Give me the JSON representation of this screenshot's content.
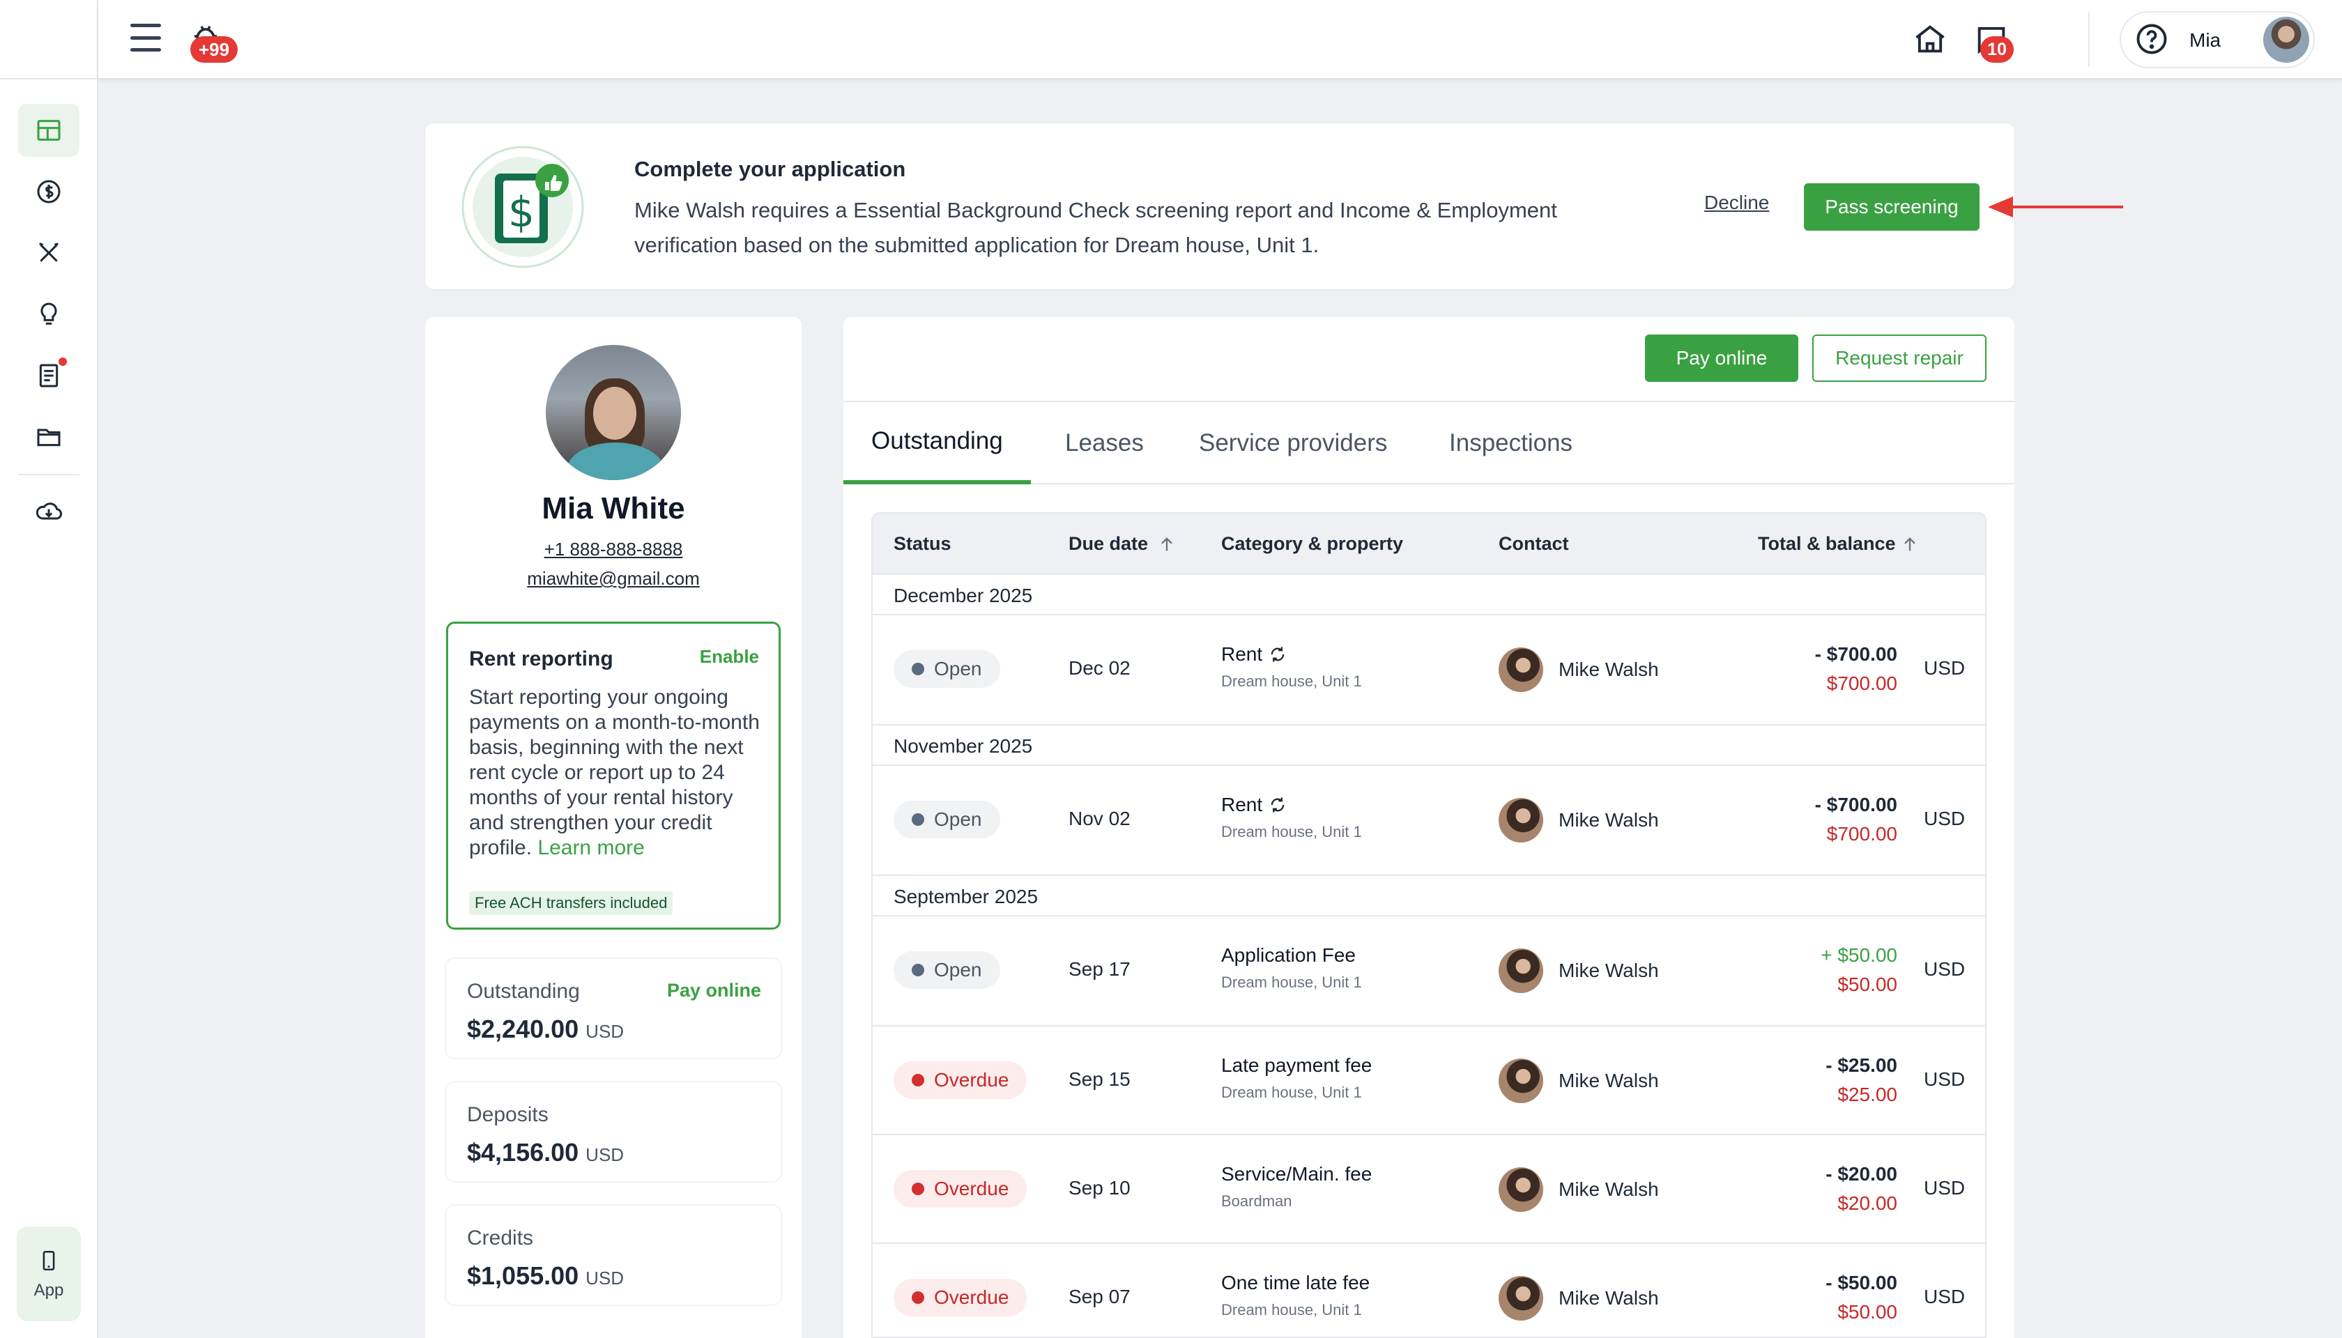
{
  "topbar": {
    "notif_count": "+99",
    "chat_count": "10",
    "user_name": "Mia"
  },
  "rail": {
    "app_label": "App"
  },
  "banner": {
    "title": "Complete your application",
    "text": "Mike Walsh requires a Essential Background Check screening report and Income & Employment verification based on the submitted application for Dream house, Unit 1.",
    "decline": "Decline",
    "pass": "Pass screening"
  },
  "profile": {
    "name": "Mia White",
    "phone": "+1 888-888-8888",
    "email": "miawhite@gmail.com",
    "rent_reporting": {
      "title": "Rent reporting",
      "enable": "Enable",
      "text": "Start reporting your ongoing payments on a month-to-month basis, beginning with the next rent cycle or report up to 24 months of your rental history and strengthen your credit profile.",
      "learn_more": "Learn more",
      "tag": "Free ACH transfers included"
    },
    "outstanding": {
      "label": "Outstanding",
      "link": "Pay online",
      "value": "$2,240.00",
      "currency": "USD"
    },
    "deposits": {
      "label": "Deposits",
      "value": "$4,156.00",
      "currency": "USD"
    },
    "credits": {
      "label": "Credits",
      "value": "$1,055.00",
      "currency": "USD"
    }
  },
  "main": {
    "pay_online": "Pay online",
    "request_repair": "Request repair",
    "tabs": [
      "Outstanding",
      "Leases",
      "Service providers",
      "Inspections"
    ],
    "columns": {
      "status": "Status",
      "due": "Due date",
      "category": "Category & property",
      "contact": "Contact",
      "total": "Total & balance"
    },
    "groups": [
      "December 2025",
      "November 2025",
      "September 2025"
    ],
    "rows": [
      {
        "status": "Open",
        "due": "Dec 02",
        "category": "Rent",
        "property": "Dream house, Unit 1",
        "contact": "Mike Walsh",
        "total": "- $700.00",
        "balance": "$700.00",
        "currency": "USD"
      },
      {
        "status": "Open",
        "due": "Nov 02",
        "category": "Rent",
        "property": "Dream house, Unit 1",
        "contact": "Mike Walsh",
        "total": "- $700.00",
        "balance": "$700.00",
        "currency": "USD"
      },
      {
        "status": "Open",
        "due": "Sep 17",
        "category": "Application Fee",
        "property": "Dream house, Unit 1",
        "contact": "Mike Walsh",
        "total": "+ $50.00",
        "balance": "$50.00",
        "currency": "USD"
      },
      {
        "status": "Overdue",
        "due": "Sep 15",
        "category": "Late payment fee",
        "property": "Dream house, Unit 1",
        "contact": "Mike Walsh",
        "total": "- $25.00",
        "balance": "$25.00",
        "currency": "USD"
      },
      {
        "status": "Overdue",
        "due": "Sep 10",
        "category": "Service/Main. fee",
        "property": "Boardman",
        "contact": "Mike Walsh",
        "total": "- $20.00",
        "balance": "$20.00",
        "currency": "USD"
      },
      {
        "status": "Overdue",
        "due": "Sep 07",
        "category": "One time late fee",
        "property": "Dream house, Unit 1",
        "contact": "Mike Walsh",
        "total": "- $50.00",
        "balance": "$50.00",
        "currency": "USD"
      }
    ]
  },
  "colors": {
    "accent": "#3aa142",
    "danger": "#d32f2f",
    "positive": "#3aa142"
  }
}
